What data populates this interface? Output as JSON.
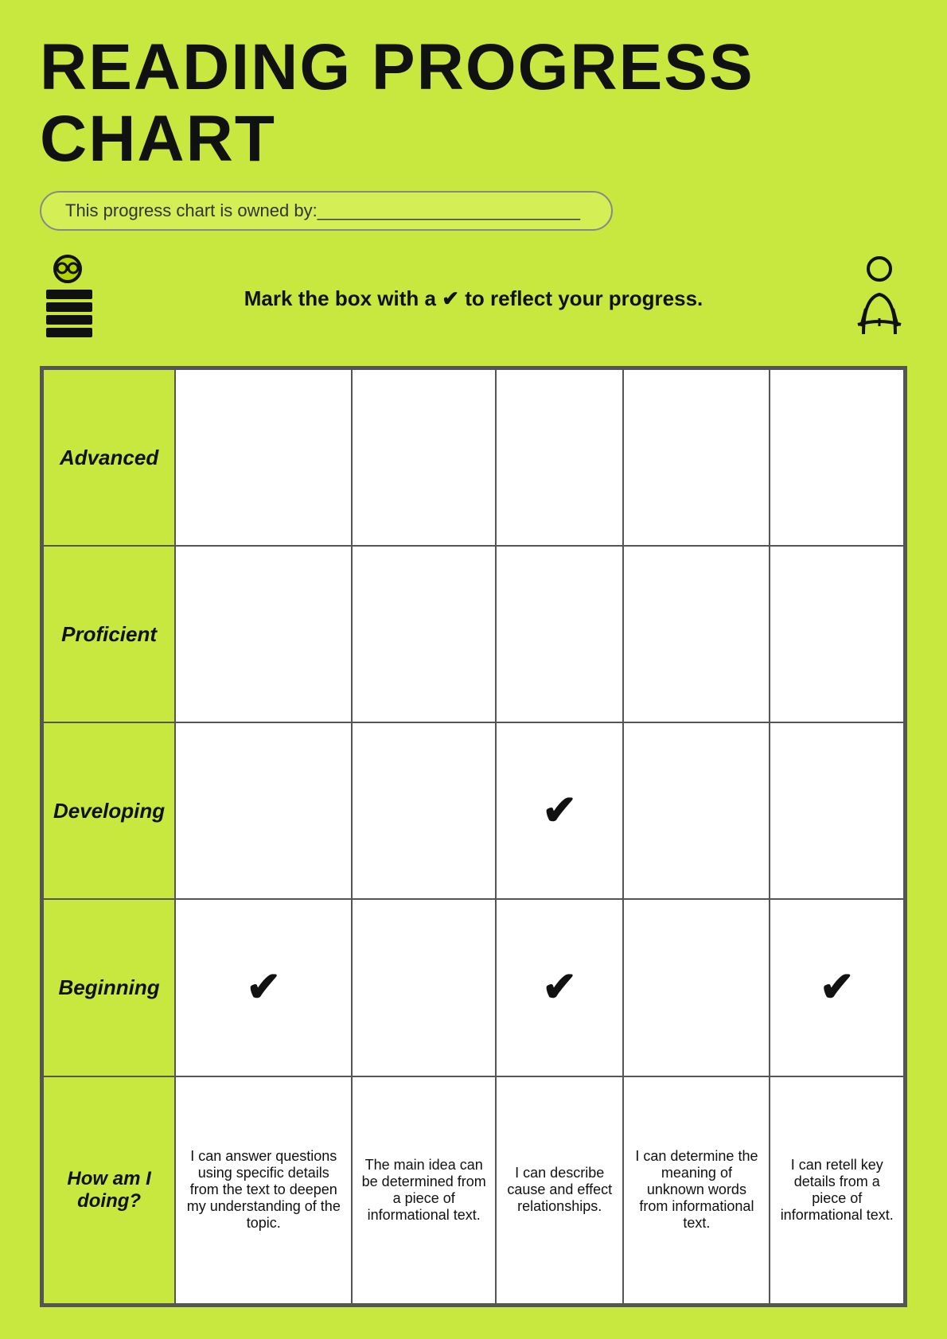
{
  "title": "READING PROGRESS CHART",
  "owner_label": "This progress chart is owned by:___________________________",
  "instruction": "Mark the box with a ✔ to reflect your progress.",
  "rows": [
    {
      "id": "advanced",
      "label": "Advanced"
    },
    {
      "id": "proficient",
      "label": "Proficient"
    },
    {
      "id": "developing",
      "label": "Developing"
    },
    {
      "id": "beginning",
      "label": "Beginning"
    },
    {
      "id": "howami",
      "label": "How am I doing?"
    }
  ],
  "checks": {
    "developing": [
      false,
      false,
      true,
      false,
      false
    ],
    "beginning": [
      true,
      false,
      true,
      false,
      true
    ]
  },
  "descriptions": [
    "I can answer questions using specific details from the text to deepen my understanding of the topic.",
    "The main idea can be determined from a piece of informational text.",
    "I can describe cause and effect relationships.",
    "I can determine the meaning of unknown words from informational text.",
    "I can retell key details from a piece of informational text."
  ]
}
